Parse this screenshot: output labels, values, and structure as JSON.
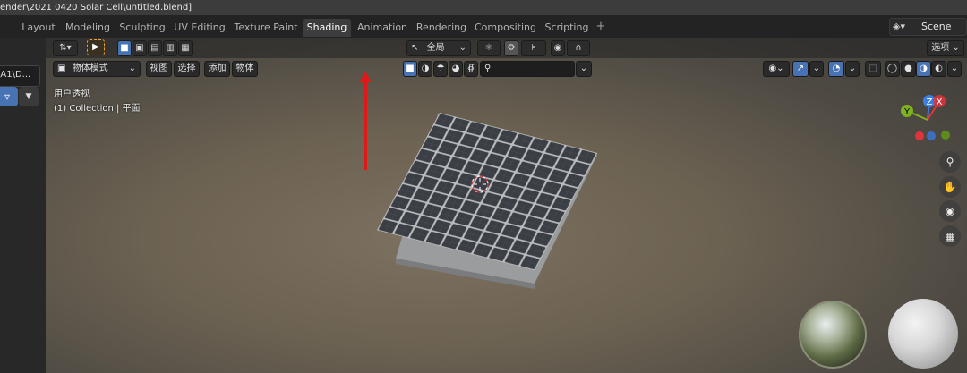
{
  "window": {
    "title": "ender\\2021 0420 Solar Cell\\untitled.blend]"
  },
  "workspaces": {
    "tabs": [
      {
        "label": "Layout"
      },
      {
        "label": "Modeling"
      },
      {
        "label": "Sculpting"
      },
      {
        "label": "UV Editing"
      },
      {
        "label": "Texture Paint"
      },
      {
        "label": "Shading"
      },
      {
        "label": "Animation"
      },
      {
        "label": "Rendering"
      },
      {
        "label": "Compositing"
      },
      {
        "label": "Scripting"
      }
    ],
    "active": "Shading",
    "add_label": "+",
    "scene_label": "Scene"
  },
  "left_panel": {
    "path_label": "\\A1\\D..."
  },
  "viewport_toolbar": {
    "transform_label": "全局",
    "options_label": "选项"
  },
  "viewport_header": {
    "mode_label": "物体模式",
    "menus": [
      "视图",
      "选择",
      "添加",
      "物体"
    ]
  },
  "overlay": {
    "view_label": "用户透视",
    "collection_label": "(1) Collection | 平面"
  },
  "gizmo": {
    "x_label": "X",
    "y_label": "Y",
    "z_label": "Z"
  },
  "colors": {
    "accent": "#4772b3",
    "arrow": "#e01818",
    "axis_x": "#e0343d",
    "axis_y": "#7fb21f",
    "axis_z": "#3d7fe0"
  },
  "icons": {
    "zoom": "zoom-icon",
    "pan": "hand-icon",
    "camera": "camera-icon",
    "ortho": "grid-icon"
  }
}
